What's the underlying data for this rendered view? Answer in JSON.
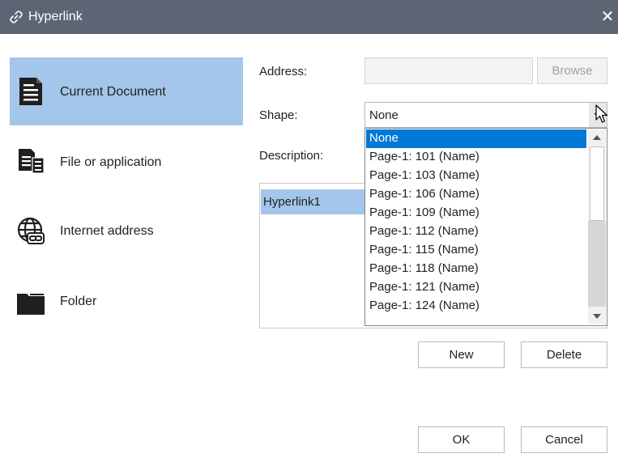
{
  "dialog": {
    "title": "Hyperlink",
    "close_glyph": "✕"
  },
  "sidebar": {
    "items": [
      {
        "label": "Current Document",
        "icon": "document-icon",
        "selected": true
      },
      {
        "label": "File or application",
        "icon": "file-application-icon",
        "selected": false
      },
      {
        "label": "Internet address",
        "icon": "globe-link-icon",
        "selected": false
      },
      {
        "label": "Folder",
        "icon": "folder-icon",
        "selected": false
      }
    ]
  },
  "form": {
    "address_label": "Address:",
    "address_value": "",
    "browse_label": "Browse",
    "shape_label": "Shape:",
    "shape_value": "None",
    "description_label": "Description:"
  },
  "dropdown": {
    "options": [
      "None",
      "Page-1: 101 (Name)",
      "Page-1: 103 (Name)",
      "Page-1: 106 (Name)",
      "Page-1: 109 (Name)",
      "Page-1: 112 (Name)",
      "Page-1: 115 (Name)",
      "Page-1: 118 (Name)",
      "Page-1: 121 (Name)",
      "Page-1: 124 (Name)"
    ],
    "selected": "None"
  },
  "hyperlink_list": {
    "items": [
      "Hyperlink1"
    ]
  },
  "buttons": {
    "new_label": "New",
    "delete_label": "Delete",
    "ok_label": "OK",
    "cancel_label": "Cancel"
  },
  "colors": {
    "titlebar": "#5d6575",
    "selection_sidebar": "#a3c6ea",
    "dropdown_highlight": "#0078d7"
  }
}
